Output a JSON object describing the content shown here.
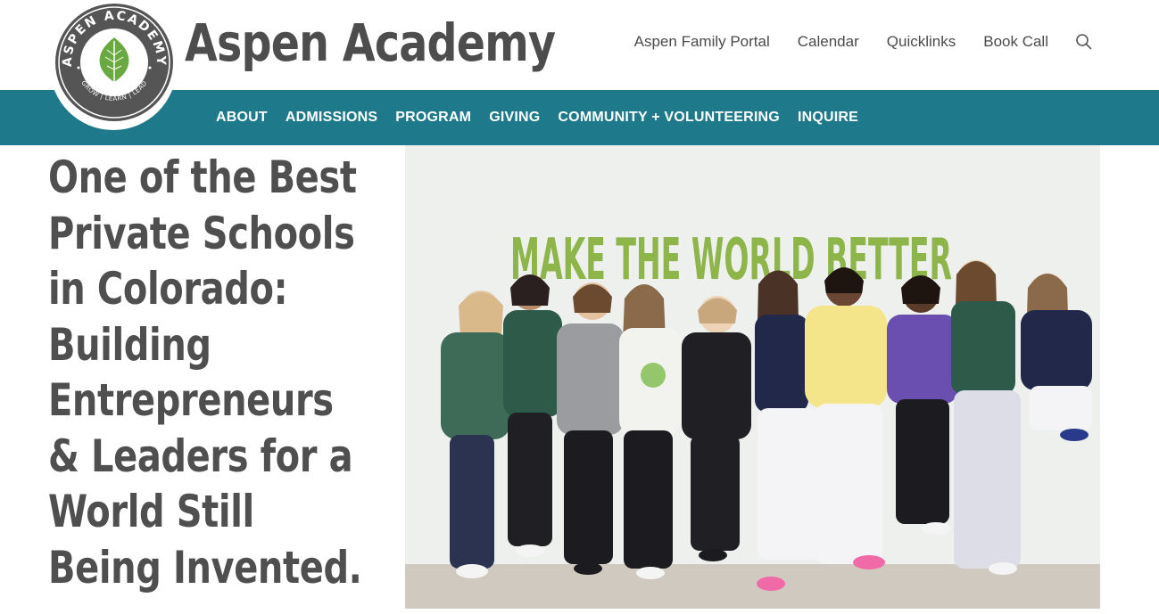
{
  "brand": {
    "name": "Aspen Academy",
    "logo_ring_text": "ASPEN ACADEMY",
    "logo_motto": "GROW | LEARN | LEAD"
  },
  "utility_nav": {
    "items": [
      "Aspen Family Portal",
      "Calendar",
      "Quicklinks",
      "Book Call"
    ],
    "search_icon": "search-icon"
  },
  "main_nav": {
    "items": [
      "ABOUT",
      "ADMISSIONS",
      "PROGRAM",
      "GIVING",
      "COMMUNITY + VOLUNTEERING",
      "INQUIRE"
    ]
  },
  "hero": {
    "headline_lines": [
      "One of the Best",
      "Private Schools",
      "in Colorado:",
      "Building",
      "Entrepreneurs",
      "& Leaders for a",
      "World Still",
      "Being Invented."
    ],
    "photo_wall_text": "MAKE THE WORLD BETTER"
  },
  "colors": {
    "nav_teal": "#1e7a8a",
    "text_gray": "#4a4a4a",
    "leaf_green": "#6aa842",
    "wall_text_green": "#8db54a"
  }
}
